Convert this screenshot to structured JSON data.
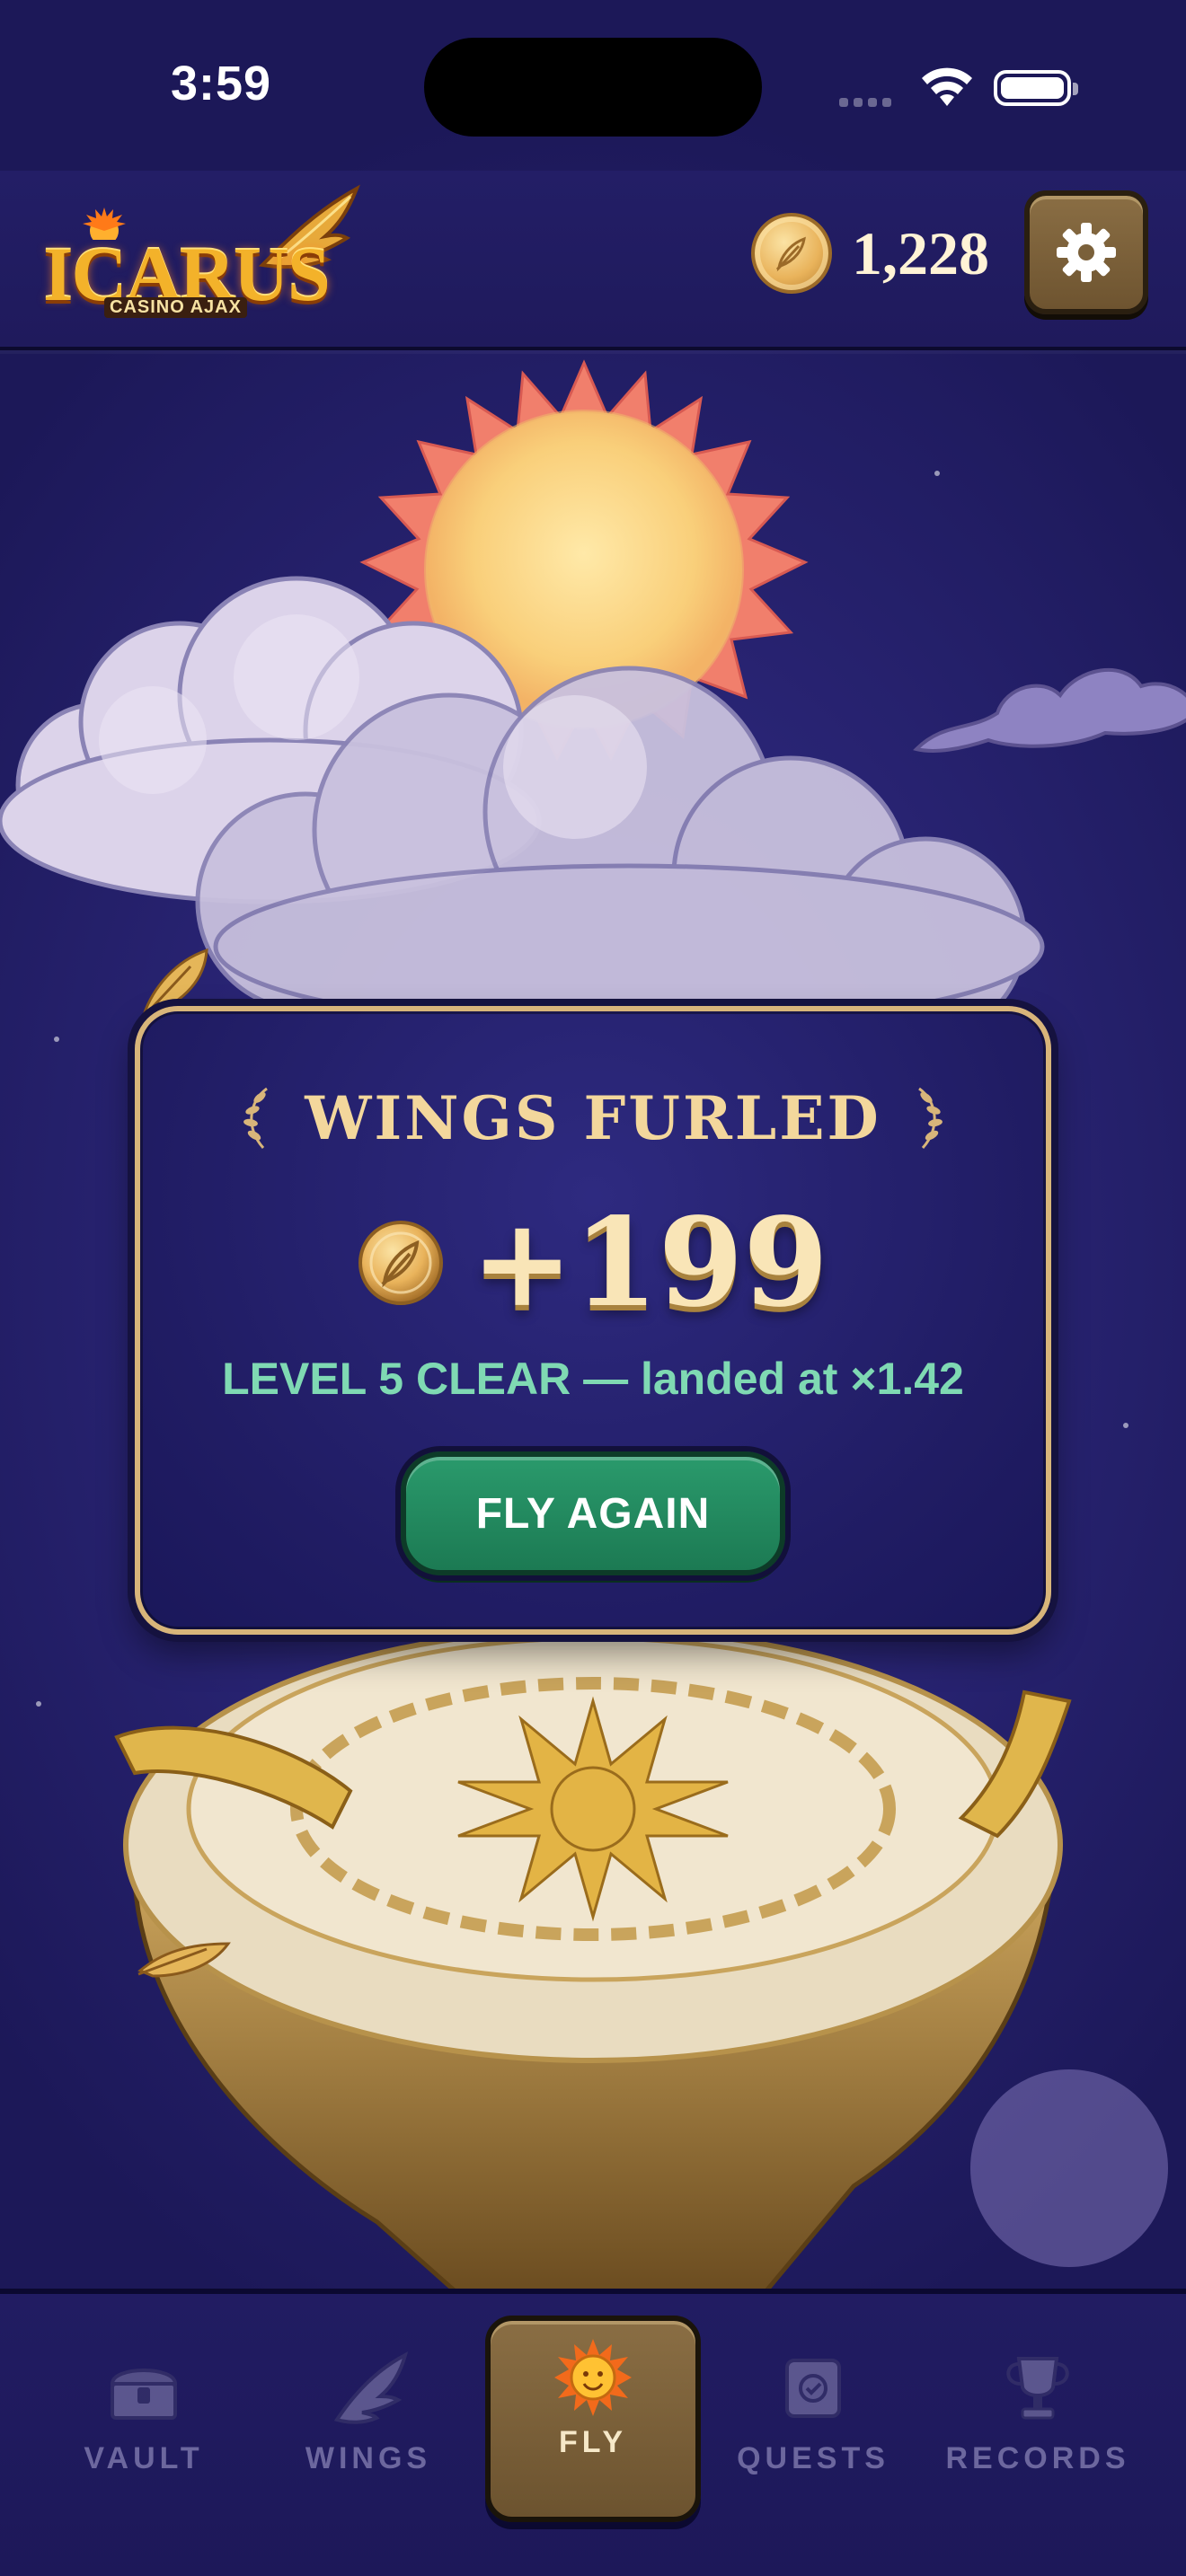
{
  "status_bar": {
    "time": "3:59"
  },
  "header": {
    "logo_text": "ICARUS",
    "logo_subtext": "CASINO AJAX",
    "coin_balance": "1,228"
  },
  "result": {
    "title": "WINGS FURLED",
    "reward": "+199",
    "subtitle": "LEVEL 5 CLEAR — landed at ×1.42",
    "button_label": "FLY AGAIN"
  },
  "tabs": [
    {
      "label": "VAULT",
      "icon": "treasure-chest-icon",
      "active": false
    },
    {
      "label": "WINGS",
      "icon": "wing-icon",
      "active": false
    },
    {
      "label": "FLY",
      "icon": "sun-face-icon",
      "active": true
    },
    {
      "label": "QUESTS",
      "icon": "scroll-icon",
      "active": false
    },
    {
      "label": "RECORDS",
      "icon": "trophy-icon",
      "active": false
    }
  ],
  "colors": {
    "background": "#241f68",
    "panel_border": "#d8b57a",
    "gold_text": "#f3d79c",
    "subtitle_green": "#7fd9b3",
    "button_green": "#1c7a53",
    "tab_active": "#7a603a",
    "tab_inactive_text": "#6c679e"
  }
}
